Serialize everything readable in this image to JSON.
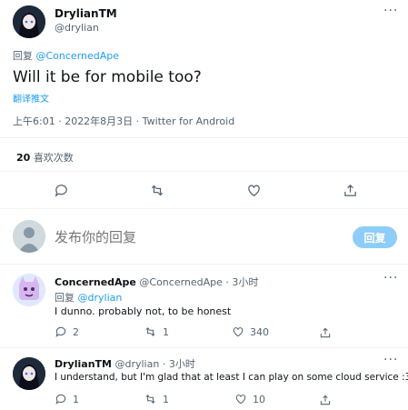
{
  "main_tweet": {
    "name": "DrylianTM",
    "handle": "@drylian",
    "reply_prefix": "回复",
    "reply_to": "@ConcernedApe",
    "text": "Will it be for mobile too?",
    "translate": "翻译推文",
    "meta": "上午6:01 · 2022年8月3日 · Twitter for Android",
    "likes_count": "20",
    "likes_label": "喜欢次数"
  },
  "compose": {
    "placeholder": "发布你的回复",
    "button": "回复"
  },
  "replies": [
    {
      "name": "ConcernedApe",
      "handle": "@ConcernedApe",
      "time": "· 3小时",
      "reply_prefix": "回复",
      "reply_to": "@drylian",
      "text": "I dunno. probably not, to be honest",
      "stats": {
        "replies": "2",
        "retweets": "1",
        "likes": "340"
      }
    },
    {
      "name": "DrylianTM",
      "handle": "@drylian",
      "time": "· 3小时",
      "text": "I understand, but I'm glad that at least I can play on some cloud service :3",
      "stats": {
        "replies": "1",
        "retweets": "1",
        "likes": "10"
      }
    }
  ],
  "colors": {
    "accent": "#1d9bf0",
    "text": "#0f1419",
    "secondary": "#536471",
    "button_disabled": "#8ecdf8"
  }
}
